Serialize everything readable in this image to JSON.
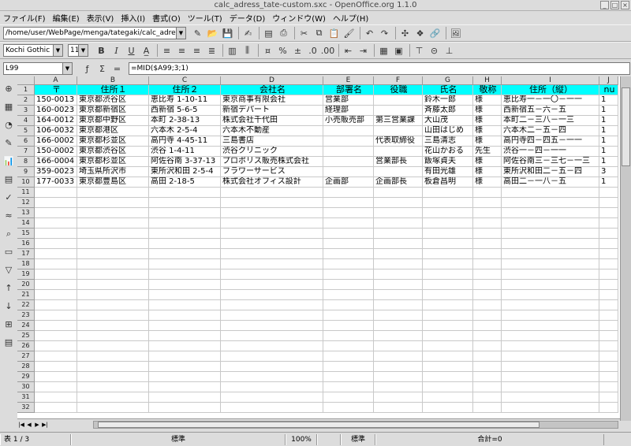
{
  "window": {
    "title": "calc_adress_tate-custom.sxc - OpenOffice.org 1.1.0"
  },
  "menu": [
    "ファイル(F)",
    "編集(E)",
    "表示(V)",
    "挿入(I)",
    "書式(O)",
    "ツール(T)",
    "データ(D)",
    "ウィンドウ(W)",
    "ヘルプ(H)"
  ],
  "toolbar": {
    "path": "/home/user/WebPage/menga/tategaki/calc_adress_"
  },
  "format": {
    "font_name": "Kochi Gothic",
    "font_size": "11",
    "bold": "B",
    "italic": "I",
    "underline": "U"
  },
  "formula": {
    "cell_ref": "L99",
    "sum_glyph": "Σ",
    "equals_glyph": "=",
    "content": "=MID($A99;3;1)"
  },
  "sheet": {
    "columns": [
      "A",
      "B",
      "C",
      "D",
      "E",
      "F",
      "G",
      "H",
      "I",
      "J"
    ],
    "row_numbers": [
      "1",
      "2",
      "3",
      "4",
      "5",
      "6",
      "7",
      "8",
      "9",
      "10",
      "11",
      "12",
      "13",
      "14",
      "15",
      "16",
      "17",
      "18",
      "19",
      "20",
      "21",
      "22",
      "23",
      "24",
      "25",
      "26",
      "27",
      "28",
      "29",
      "30",
      "31",
      "32"
    ],
    "header": [
      "〒",
      "住所１",
      "住所２",
      "会社名",
      "部署名",
      "役職",
      "氏名",
      "敬称",
      "住所（縦）",
      "nu"
    ],
    "rows": [
      [
        "150-0013",
        "東京都渋谷区",
        "恵比寿 1-10-11",
        "東京商事有限会社",
        "営業部",
        "",
        "鈴木一郎",
        "様",
        "恵比寿一－一〇－一一",
        "1"
      ],
      [
        "160-0023",
        "東京都新宿区",
        "西新宿 5-6-5",
        "新宿デパート",
        "経理部",
        "",
        "斉藤太郎",
        "様",
        "西新宿五－六－五",
        "1"
      ],
      [
        "164-0012",
        "東京都中野区",
        "本町 2-38-13",
        "株式会社千代田",
        "小売販売部",
        "第三営業課",
        "大山茂",
        "様",
        "本町二－三八－一三",
        "1"
      ],
      [
        "106-0032",
        "東京都港区",
        "六本木 2-5-4",
        "六本木不動産",
        "",
        "",
        "山田はじめ",
        "様",
        "六本木二－五－四",
        "1"
      ],
      [
        "166-0002",
        "東京都杉並区",
        "高円寺 4-45-11",
        "三島書店",
        "",
        "代表取締役",
        "三島清志",
        "様",
        "高円寺四－四五－一一",
        "1"
      ],
      [
        "150-0002",
        "東京都渋谷区",
        "渋谷 1-4-11",
        "渋谷クリニック",
        "",
        "",
        "花山かおる",
        "先生",
        "渋谷一－四－一一",
        "1"
      ],
      [
        "166-0004",
        "東京都杉並区",
        "阿佐谷南 3-37-13",
        "プロポリス販売株式会社",
        "",
        "営業部長",
        "飯塚貞夫",
        "様",
        "阿佐谷南三－三七－一三",
        "1"
      ],
      [
        "359-0023",
        "埼玉県所沢市",
        "東所沢和田 2-5-4",
        "フラワーサービス",
        "",
        "",
        "有田光雄",
        "様",
        "東所沢和田二－五－四",
        "3"
      ],
      [
        "177-0033",
        "東京都豊島区",
        "高田 2-18-5",
        "株式会社オフィス設計",
        "企画部",
        "企画部長",
        "板倉昌明",
        "様",
        "高田二－一八－五",
        "1"
      ]
    ]
  },
  "status": {
    "sheet": "表 1 / 3",
    "style": "標準",
    "zoom": "100%",
    "mode": "標準",
    "sum": "合計=0"
  }
}
